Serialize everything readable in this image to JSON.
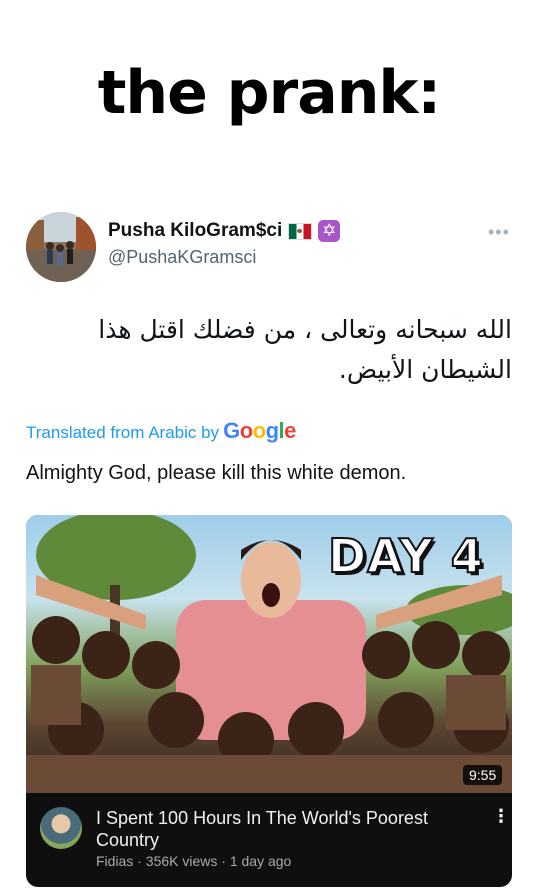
{
  "meme_caption": "the prank:",
  "tweet": {
    "author_name": "Pusha KiloGram$ci",
    "author_handle": "@PushaKGramsci",
    "text_arabic": "الله سبحانه وتعالى ، من فضلك اقتل هذا الشيطان الأبيض.",
    "translated_prefix": "Translated from Arabic by",
    "translation_provider": "Google",
    "text_english": "Almighty God, please kill this white demon."
  },
  "video": {
    "thumbnail_text": "DAY 4",
    "duration": "9:55",
    "title": "I Spent 100 Hours In The World's Poorest Country",
    "meta": "Fidias · 356K views · 1 day ago"
  },
  "icons": {
    "flag": "mexico-flag-icon",
    "badge": "star-of-david-icon",
    "more": "more-dots-icon",
    "video_menu": "vertical-dots-icon"
  },
  "colors": {
    "link": "#1d9bf0",
    "handle": "#536471",
    "video_bg": "#0f0f0f"
  }
}
